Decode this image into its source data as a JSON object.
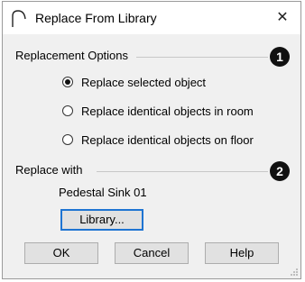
{
  "window": {
    "title": "Replace From Library",
    "close_glyph": "✕"
  },
  "replacement_options": {
    "label": "Replacement Options",
    "callout": "1",
    "options": [
      {
        "label": "Replace selected object",
        "checked": true
      },
      {
        "label": "Replace identical objects in room",
        "checked": false
      },
      {
        "label": "Replace identical objects on floor",
        "checked": false
      }
    ]
  },
  "replace_with": {
    "label": "Replace with",
    "callout": "2",
    "item_name": "Pedestal Sink 01",
    "library_button": "Library..."
  },
  "buttons": {
    "ok": "OK",
    "cancel": "Cancel",
    "help": "Help"
  },
  "icons": {
    "title": "library-arc-icon",
    "close": "close-icon"
  }
}
